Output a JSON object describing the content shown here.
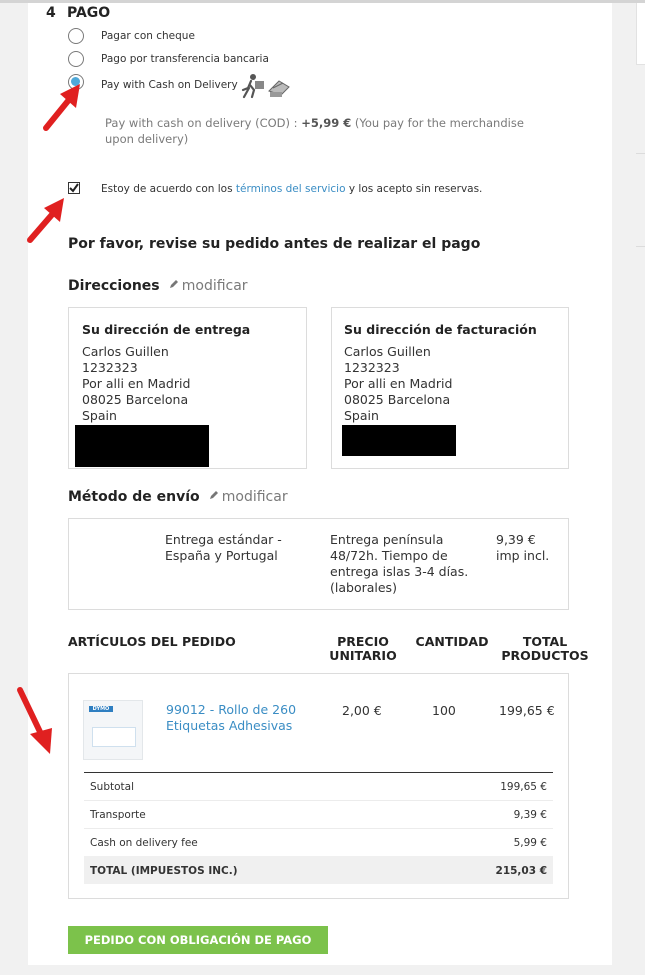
{
  "payment": {
    "step_number": "4",
    "step_title": "PAGO",
    "options": [
      {
        "label": "Pagar con cheque",
        "selected": false
      },
      {
        "label": "Pago por transferencia bancaria",
        "selected": false
      },
      {
        "label": "Pay with Cash on Delivery",
        "selected": true
      }
    ],
    "cod_note_prefix": "Pay with cash on delivery (COD) : ",
    "cod_fee": "+5,99 €",
    "cod_note_suffix": "  (You pay for the merchandise upon delivery)",
    "terms_prefix": "Estoy de acuerdo con los ",
    "terms_link": "términos del servicio",
    "terms_suffix": " y los acepto sin reservas.",
    "terms_checked": true
  },
  "review": {
    "heading": "Por favor, revise su pedido antes de realizar el pago",
    "addresses_heading": "Direcciones",
    "modify_label": "modificar",
    "delivery": {
      "title": "Su dirección de entrega",
      "lines": [
        "Carlos Guillen",
        "1232323",
        "Por alli en Madrid",
        "08025 Barcelona",
        "Spain"
      ]
    },
    "invoice": {
      "title": "Su dirección de facturación",
      "lines": [
        "Carlos Guillen",
        "1232323",
        "Por alli en Madrid",
        "08025 Barcelona",
        "Spain"
      ]
    },
    "shipping_heading": "Método de envío",
    "shipping": {
      "name_line1": "Entrega estándar -",
      "name_line2": "España y Portugal",
      "desc_lines": [
        "Entrega península",
        "48/72h. Tiempo de",
        "entrega islas 3-4 días.",
        "(laborales)"
      ],
      "price_line1": "9,39 €",
      "price_line2": "imp incl."
    }
  },
  "items": {
    "headers": {
      "articles": "ARTÍCULOS DEL PEDIDO",
      "unit_price_1": "PRECIO",
      "unit_price_2": "UNITARIO",
      "quantity": "CANTIDAD",
      "total_1": "TOTAL",
      "total_2": "PRODUCTOS"
    },
    "rows": [
      {
        "name_line1": "99012 - Rollo de 260",
        "name_line2": "Etiquetas Adhesivas",
        "unit_price": "2,00 €",
        "quantity": "100",
        "total": "199,65 €",
        "thumb_brand": "DYMO"
      }
    ],
    "summary": [
      {
        "label": "Subtotal",
        "value": "199,65 €"
      },
      {
        "label": "Transporte",
        "value": "9,39 €"
      },
      {
        "label": "Cash on delivery fee",
        "value": "5,99 €"
      }
    ],
    "total_label": "TOTAL (IMPUESTOS INC.)",
    "total_value": "215,03 €"
  },
  "submit_label": "PEDIDO CON OBLIGACIÓN DE PAGO",
  "colors": {
    "accent_link": "#3a8dc4",
    "button_green": "#7cc24b",
    "arrow_red": "#e02020"
  }
}
